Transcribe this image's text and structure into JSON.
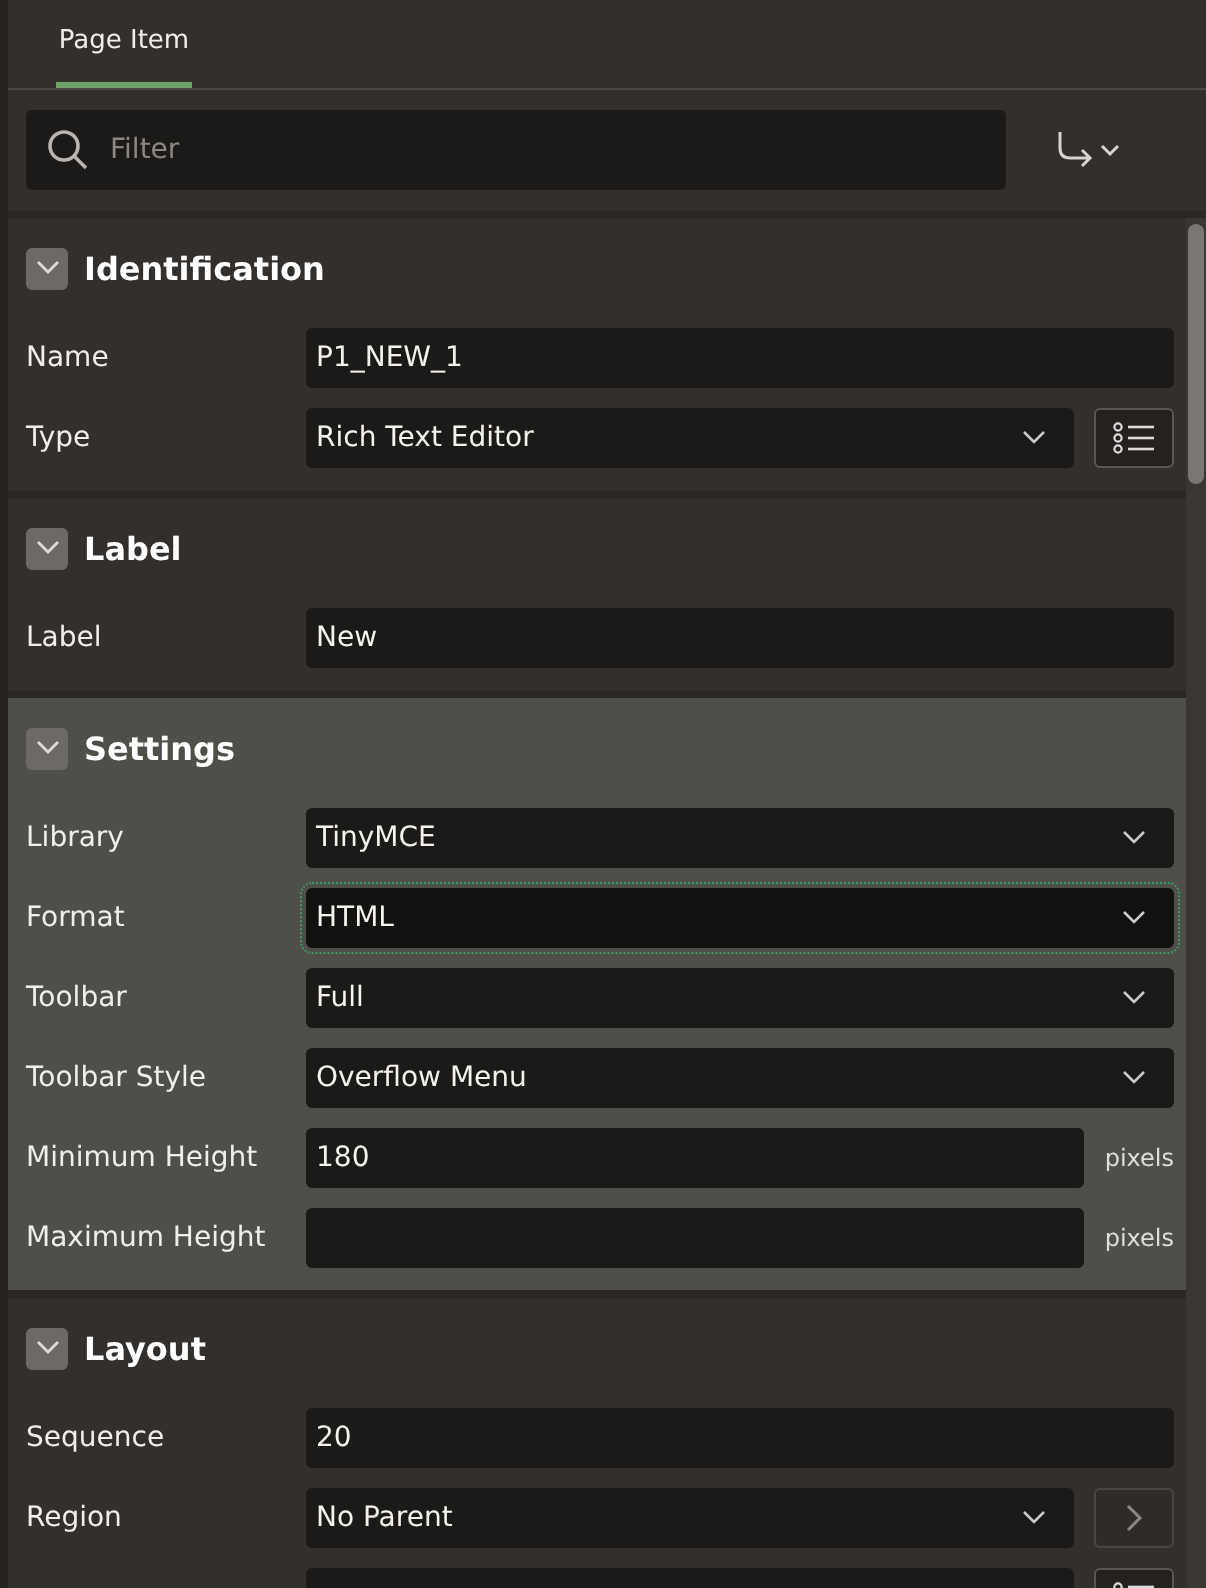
{
  "tabs": [
    {
      "label": "Page Item",
      "selected": true
    }
  ],
  "filter": {
    "placeholder": "Filter"
  },
  "sections": [
    {
      "title": "Identification",
      "expanded": true,
      "current": false,
      "rows": [
        {
          "kind": "text",
          "label": "Name",
          "value": "P1_NEW_1",
          "focused": false
        },
        {
          "kind": "select",
          "label": "Type",
          "value": "Rich Text Editor",
          "focused": false,
          "button": {
            "kind": "list"
          }
        }
      ]
    },
    {
      "title": "Label",
      "expanded": true,
      "current": false,
      "rows": [
        {
          "kind": "text",
          "label": "Label",
          "value": "New",
          "focused": false
        }
      ]
    },
    {
      "title": "Settings",
      "expanded": true,
      "current": true,
      "rows": [
        {
          "kind": "select",
          "label": "Library",
          "value": "TinyMCE",
          "focused": false
        },
        {
          "kind": "select",
          "label": "Format",
          "value": "HTML",
          "focused": true
        },
        {
          "kind": "select",
          "label": "Toolbar",
          "value": "Full",
          "focused": false
        },
        {
          "kind": "select",
          "label": "Toolbar Style",
          "value": "Overflow Menu",
          "focused": false
        },
        {
          "kind": "text",
          "label": "Minimum Height",
          "value": "180",
          "suffix": "pixels",
          "focused": false
        },
        {
          "kind": "text",
          "label": "Maximum Height",
          "suffix": "pixels",
          "focused": false
        }
      ]
    },
    {
      "title": "Layout",
      "expanded": true,
      "current": false,
      "rows": [
        {
          "kind": "text",
          "label": "Sequence",
          "value": "20",
          "focused": false
        },
        {
          "kind": "select",
          "label": "Region",
          "value": "No Parent",
          "focused": false,
          "button": {
            "kind": "next"
          }
        },
        {
          "kind": "select",
          "focused": false,
          "button": {
            "kind": "list"
          }
        }
      ]
    }
  ]
}
